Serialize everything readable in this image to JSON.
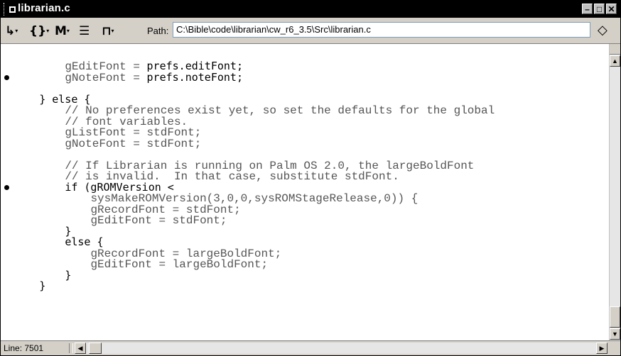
{
  "window": {
    "title": "librarian.c"
  },
  "toolbar": {
    "icons": [
      "function-menu-icon",
      "brace-menu-icon",
      "marker-menu-icon",
      "document-menu-icon",
      "lock-menu-icon"
    ],
    "path_label": "Path:",
    "path_value": "C:\\Bible\\code\\librarian\\cw_r6_3.5\\Src\\librarian.c"
  },
  "editor": {
    "lines": [
      {
        "indent": "          ",
        "code": "gEditFont = ",
        "kw": "prefs.editFont;",
        "bp": false
      },
      {
        "indent": "          ",
        "code": "gNoteFont = ",
        "kw": "prefs.noteFont;",
        "bp": true
      },
      {
        "indent": "",
        "code": "",
        "kw": "",
        "bp": false
      },
      {
        "indent": "      ",
        "code": "",
        "kw": "} else {",
        "bp": false
      },
      {
        "indent": "          ",
        "code": "// No preferences exist yet, so set the defaults for the global",
        "kw": "",
        "bp": false
      },
      {
        "indent": "          ",
        "code": "// font variables.",
        "kw": "",
        "bp": false
      },
      {
        "indent": "          ",
        "code": "gListFont = stdFont;",
        "kw": "",
        "bp": false
      },
      {
        "indent": "          ",
        "code": "gNoteFont = stdFont;",
        "kw": "",
        "bp": false
      },
      {
        "indent": "",
        "code": "",
        "kw": "",
        "bp": false
      },
      {
        "indent": "          ",
        "code": "// If Librarian is running on Palm OS 2.0, the largeBoldFont",
        "kw": "",
        "bp": false
      },
      {
        "indent": "          ",
        "code": "// is invalid.  In that case, substitute stdFont.",
        "kw": "",
        "bp": false
      },
      {
        "indent": "          ",
        "code": "",
        "kw": "if (gROMVersion <",
        "bp": true
      },
      {
        "indent": "              ",
        "code": "sysMakeROMVersion(3,0,0,sysROMStageRelease,0)) {",
        "kw": "",
        "bp": false
      },
      {
        "indent": "              ",
        "code": "gRecordFont = stdFont;",
        "kw": "",
        "bp": false
      },
      {
        "indent": "              ",
        "code": "gEditFont = stdFont;",
        "kw": "",
        "bp": false
      },
      {
        "indent": "          ",
        "code": "",
        "kw": "}",
        "bp": false
      },
      {
        "indent": "          ",
        "code": "",
        "kw": "else {",
        "bp": false
      },
      {
        "indent": "              ",
        "code": "gRecordFont = largeBoldFont;",
        "kw": "",
        "bp": false
      },
      {
        "indent": "              ",
        "code": "gEditFont = largeBoldFont;",
        "kw": "",
        "bp": false
      },
      {
        "indent": "          ",
        "code": "",
        "kw": "}",
        "bp": false
      },
      {
        "indent": "      ",
        "code": "",
        "kw": "}",
        "bp": false
      }
    ]
  },
  "status": {
    "line": "Line: 7501"
  }
}
